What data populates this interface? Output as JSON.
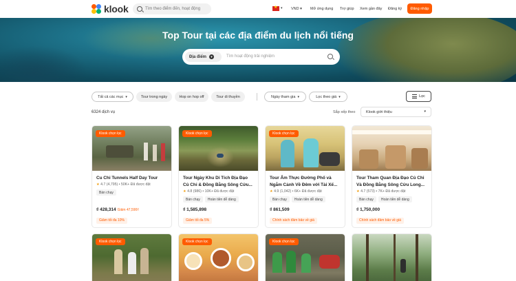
{
  "header": {
    "logo_text": "klook",
    "search_placeholder": "Tìm theo điểm đến, hoạt động",
    "currency": "VND",
    "nav": [
      "Mở ứng dụng",
      "Trợ giúp",
      "Xem gần đây",
      "Đăng ký"
    ],
    "login": "Đăng nhập"
  },
  "hero": {
    "title": "Top Tour tại các địa điểm du lịch nổi tiếng",
    "place_label": "Địa điểm",
    "search_placeholder": "Tìm hoạt động trải nghiệm"
  },
  "filters": {
    "chips": [
      "Tất cả các mục",
      "Tour trong ngày",
      "Hop on hop off",
      "Tour di thuyền"
    ],
    "dropdowns": [
      "Ngày tham gia",
      "Lọc theo giá"
    ],
    "filter_button": "Lọc"
  },
  "results": {
    "count": "6324 dịch vụ",
    "sort_label": "Sắp xếp theo",
    "sort_value": "Klook giới thiệu"
  },
  "cards": [
    {
      "badge": "Klook chọn lọc",
      "title": "Cu Chi Tunnels Half Day Tour",
      "rating": "4.7",
      "rating_meta": "(4,795) • 50K+ Đã được đặt",
      "tags": [
        "Bán chạy"
      ],
      "price": "₫ 428,314",
      "old_price": "Giảm 47,590₫",
      "promo": "Giảm tối đa 10%"
    },
    {
      "badge": "Klook chọn lọc",
      "title": "Tour Ngày Khu Di Tích Địa Đạo Củ Chi & Đồng Bằng Sông Cửu...",
      "rating": "4.8",
      "rating_meta": "(986) • 10K+ Đã được đặt",
      "tags": [
        "Bán chạy",
        "Hoàn tiền dễ dàng"
      ],
      "price": "₫ 1,585,898",
      "old_price": "",
      "promo": "Giảm tối đa 5%"
    },
    {
      "badge": "Klook chọn lọc",
      "title": "Tour Ẩm Thực Đường Phố và Ngắm Cảnh Về Đêm với Tài Xế...",
      "rating": "4.9",
      "rating_meta": "(1,042) • 6K+ Đã được đặt",
      "tags": [
        "Bán chạy",
        "Hoàn tiền dễ dàng"
      ],
      "price": "₫ 861,509",
      "old_price": "",
      "promo": "Chính sách đảm bảo về giá"
    },
    {
      "badge": "",
      "title": "Tour Tham Quan Địa Đạo Củ Chi Và Đồng Bằng Sông Cửu Long...",
      "rating": "4.7",
      "rating_meta": "(573) • 7K+ Đã được đặt",
      "tags": [
        "Bán chạy",
        "Hoàn tiền dễ dàng"
      ],
      "price": "₫ 1,750,000",
      "old_price": "",
      "promo": "Chính sách đảm bảo về giá"
    }
  ],
  "cards_row2": [
    {
      "badge": "Klook chọn lọc"
    },
    {
      "badge": "Klook chọn lọc"
    },
    {
      "badge": "Klook chọn lọc"
    },
    {
      "badge": ""
    }
  ],
  "colors": {
    "brand": "#ff5b00",
    "star": "#f09b0a"
  }
}
